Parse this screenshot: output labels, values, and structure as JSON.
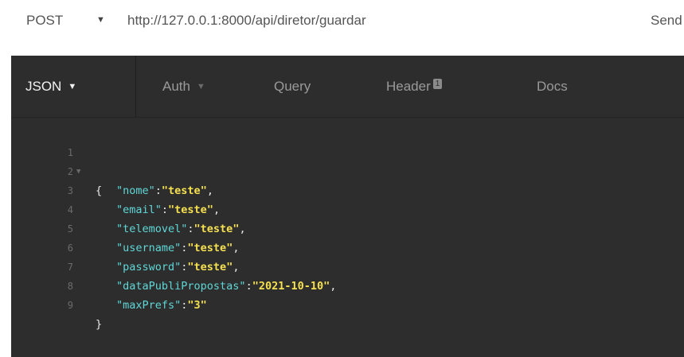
{
  "request": {
    "method": "POST",
    "url": "http://127.0.0.1:8000/api/diretor/guardar",
    "send_label": "Send"
  },
  "tabs": [
    {
      "label": "JSON",
      "active": true
    },
    {
      "label": "Auth",
      "active": false
    },
    {
      "label": "Query",
      "active": false
    },
    {
      "label": "Header",
      "active": false,
      "badge": "1"
    },
    {
      "label": "Docs",
      "active": false
    }
  ],
  "editor": {
    "open_brace": "{",
    "close_brace": "}",
    "entries": [
      {
        "key": "\"nome\"",
        "value": "\"teste\"",
        "comma": ","
      },
      {
        "key": "\"email\"",
        "value": "\"teste\"",
        "comma": ","
      },
      {
        "key": "\"telemovel\"",
        "value": "\"teste\"",
        "comma": ","
      },
      {
        "key": "\"username\"",
        "value": "\"teste\"",
        "comma": ","
      },
      {
        "key": "\"password\"",
        "value": "\"teste\"",
        "comma": ","
      },
      {
        "key": "\"dataPubliPropostas\"",
        "value": "\"2021-10-10\"",
        "comma": ","
      },
      {
        "key": "\"maxPrefs\"",
        "value": "\"3\"",
        "comma": ""
      }
    ],
    "line_numbers": [
      "1",
      "2",
      "3",
      "4",
      "5",
      "6",
      "7",
      "8",
      "9"
    ]
  },
  "colors": {
    "key": "#5fd7d7",
    "value": "#f5e050",
    "background": "#2d2d2d"
  }
}
